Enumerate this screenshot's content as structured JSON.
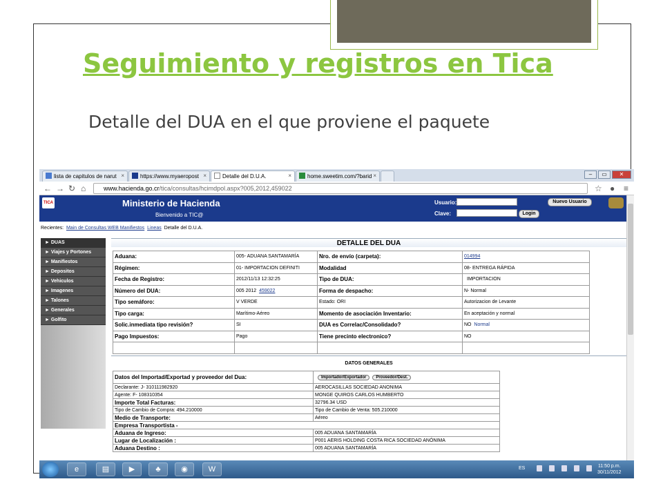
{
  "slide": {
    "title": "Seguimiento y registros en Tica",
    "subtitle": "Detalle del DUA  en el que proviene el paquete"
  },
  "browser": {
    "tabs": [
      {
        "label": "lista de capitulos de narut",
        "active": false
      },
      {
        "label": "https://www.myaeropost",
        "active": false
      },
      {
        "label": "Detalle del D.U.A.",
        "active": true
      },
      {
        "label": "home.sweetim.com/?barid",
        "active": false
      }
    ],
    "address_domain": "www.hacienda.go.cr",
    "address_path": "/tica/consultas/hcimdpol.aspx?005,2012,459022"
  },
  "site": {
    "ministry": "Ministerio de Hacienda",
    "welcome": "Bienvenido a TIC@",
    "usuario_label": "Usuario:",
    "clave_label": "Clave:",
    "nuevo_usuario": "Nuevo Usuario",
    "login": "Login",
    "logo": "TICA"
  },
  "recents": {
    "label": "Recientes:",
    "link1": "Main de Consultas WEB Manifiestos",
    "link2": "Lineas",
    "current": "Detalle del D.U.A."
  },
  "sidebar": [
    "► DUAS",
    "► Viajes y Portones",
    "► Manifiestos",
    "► Depositos",
    "► Vehiculos",
    "► Imagenes",
    "► Talones",
    "► Generales",
    "► Golfito"
  ],
  "detalle": {
    "heading": "DETALLE DEL DUA",
    "rows": [
      {
        "l1": "Aduana:",
        "v1": "005- ADUANA SANTAMARÍA",
        "l2": "Nro. de envío (carpeta):",
        "v2": "014994"
      },
      {
        "l1": "Régimen:",
        "v1": "01- IMPORTACION DEFINITI",
        "l2": "Modalidad",
        "v2": "08- ENTREGA RÁPIDA"
      },
      {
        "l1": "Fecha de Registro:",
        "v1": "2012/11/13  12:32:25",
        "l2": "Tipo de DUA:",
        "v2": "IMPORTACION"
      },
      {
        "l1": "Número del DUA:",
        "v1a": "005  2012",
        "v1b": "459022",
        "l2": "Forma de despacho:",
        "v2": "N- Normal"
      },
      {
        "l1": "Tipo semáforo:",
        "v1": "V      VERDE",
        "l2": "Estado:",
        "l2v": "ORI",
        "v2": "Autorizacion de Levante"
      },
      {
        "l1": "Tipo carga:",
        "v1": "Marítimo-Aéreo",
        "l2": "Momento de asociación Inventario:",
        "v2": "En aceptación y normal"
      },
      {
        "l1": "Solic.inmediata tipo revisión?",
        "v1": "SI",
        "l2": "DUA es Correlac/Consolidado?",
        "v2a": "NO",
        "v2b": "Normal"
      },
      {
        "l1": "Pago Impuestos:",
        "v1": "Pago",
        "l2": "Tiene precinto electronico?",
        "v2": "NO"
      }
    ]
  },
  "generales": {
    "heading": "DATOS GENERALES",
    "header_label": "Datos del Importad/Exportad y proveedor del Dua:",
    "btn_importador": "Importador/Exportador",
    "btn_proveedor": "Proveedor/Dest.",
    "declarante_label": "Declarante:",
    "declarante_id": "J- 310111982920",
    "declarante_name": "AEROCASILLAS SOCIEDAD ANONIMA",
    "agente_label": "Agente:",
    "agente_id": "F- 108310354",
    "agente_name": "MONGE QUIROS CARLOS HUMBERTO",
    "importe_label": "Importe Total Facturas:",
    "importe_value": "32796.34  USD",
    "compra_label": "Tipo de Cambio de Compra:",
    "compra_value": "494.210000",
    "venta_label": "Tipo de Cambio de Venta:",
    "venta_value": "505.210000",
    "medio_label": "Medio de Transporte:",
    "medio_value": "Aéreo",
    "empresa_label": "Empresa Transportista -",
    "ingreso_label": "Aduana de Ingreso:",
    "ingreso_value": "005  ADUANA SANTAMARÍA",
    "lugar_label": "Lugar de Localización :",
    "lugar_value": "P001  AERIS HOLDING COSTA RICA SOCIEDAD ANÓNIMA",
    "destino_label": "Aduana Destino :",
    "destino_value": "005  ADUANA SANTAMARÍA"
  },
  "taskbar": {
    "lang": "ES",
    "time": "11:50 p.m.",
    "date": "30/11/2012"
  }
}
